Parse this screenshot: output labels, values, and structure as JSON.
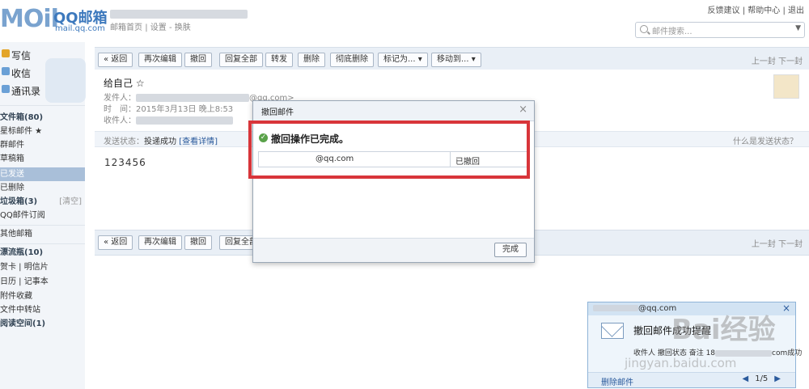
{
  "header": {
    "logo_mark": "MOil",
    "brand": "QQ邮箱",
    "domain": "mail.qq.com",
    "account_links": [
      "邮箱首页",
      "设置",
      "换肤"
    ],
    "top_links": [
      "反馈建议",
      "帮助中心",
      "退出"
    ],
    "search_placeholder": "邮件搜索..."
  },
  "sidebar": {
    "primary": [
      {
        "label": "写信",
        "icon": "pencil-icon",
        "color": "#e3a52a"
      },
      {
        "label": "收信",
        "icon": "inbox-icon",
        "color": "#6aa0d6"
      },
      {
        "label": "通讯录",
        "icon": "contacts-icon",
        "color": "#6aa0d6"
      }
    ],
    "folders": [
      {
        "label": "文件箱(80)",
        "bold": true
      },
      {
        "label": "星标邮件 ★",
        "bold": false
      },
      {
        "label": "群邮件",
        "bold": false
      },
      {
        "label": "草稿箱",
        "bold": false
      },
      {
        "label": "已发送",
        "bold": false,
        "selected": true
      },
      {
        "label": "已删除",
        "bold": false
      },
      {
        "label": "垃圾箱(3)",
        "bold": true,
        "extra": "[清空]"
      },
      {
        "label": "QQ邮件订阅",
        "bold": false
      }
    ],
    "other_label": "其他邮箱",
    "extras": [
      {
        "label": "漂流瓶(10)",
        "bold": true
      },
      {
        "label": "贺卡 | 明信片",
        "bold": false
      },
      {
        "label": "日历 | 记事本",
        "bold": false
      },
      {
        "label": "附件收藏",
        "bold": false
      },
      {
        "label": "文件中转站",
        "bold": false
      },
      {
        "label": "阅读空间(1)",
        "bold": true
      }
    ]
  },
  "toolbar": {
    "back": "« 返回",
    "buttons": [
      "再次编辑",
      "撤回",
      "回复全部",
      "转发",
      "删除",
      "彻底删除",
      "标记为... ▾",
      "移动到... ▾"
    ],
    "nav": "上一封 下一封"
  },
  "mail": {
    "subject": "给自己 ☆",
    "sender_label": "发件人：",
    "sender_suffix": "@qq.com>",
    "time_label": "时　间：",
    "time_value": "2015年3月13日 晚上8:53",
    "recipient_label": "收件人：",
    "status_label": "发送状态：",
    "status_value": "投递成功",
    "status_link": "[查看详情]",
    "status_help": "什么是发送状态？",
    "body": "123456"
  },
  "modal": {
    "title": "撤回邮件",
    "close": "×",
    "message": "撤回操作已完成。",
    "recipient_suffix": "@qq.com",
    "result": "已撤回",
    "done_button": "完成"
  },
  "toast": {
    "from_suffix": "@qq.com",
    "close": "×",
    "title": "撤回邮件成功提醒",
    "detail_prefix": "收件人 撤回状态 奋注 18",
    "detail_suffix": "com成功",
    "delete_label": "删除邮件",
    "prev": "◀",
    "page": "1/5",
    "next": "▶"
  },
  "watermark": {
    "brand": "Bai经验",
    "url": "jingyan.baidu.com"
  },
  "colors": {
    "accent": "#3d79bd",
    "highlight_box": "#d8353a",
    "selected_folder": "#a9bfd9",
    "success": "#5aa24a"
  }
}
